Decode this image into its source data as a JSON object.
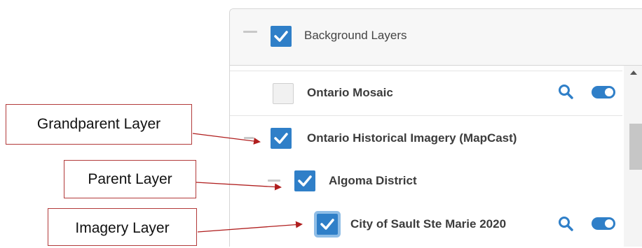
{
  "panel": {
    "header": {
      "title": "Background Layers",
      "checked": true
    },
    "rows": [
      {
        "label": "Ontario Mosaic",
        "checked": false,
        "icons": [
          "search-icon",
          "toggle-icon"
        ]
      },
      {
        "label": "Ontario Historical Imagery (MapCast)",
        "checked": true,
        "icons": []
      },
      {
        "label": "Algoma District",
        "checked": true,
        "icons": []
      },
      {
        "label": "City of Sault Ste Marie 2020",
        "checked": true,
        "icons": [
          "search-icon",
          "toggle-icon"
        ]
      }
    ]
  },
  "callouts": {
    "grandparent": "Grandparent Layer",
    "parent": "Parent Layer",
    "imagery": "Imagery Layer"
  },
  "colors": {
    "accent": "#2f7fc8",
    "callout_border": "#b23a3a",
    "arrow": "#b01e1e"
  }
}
